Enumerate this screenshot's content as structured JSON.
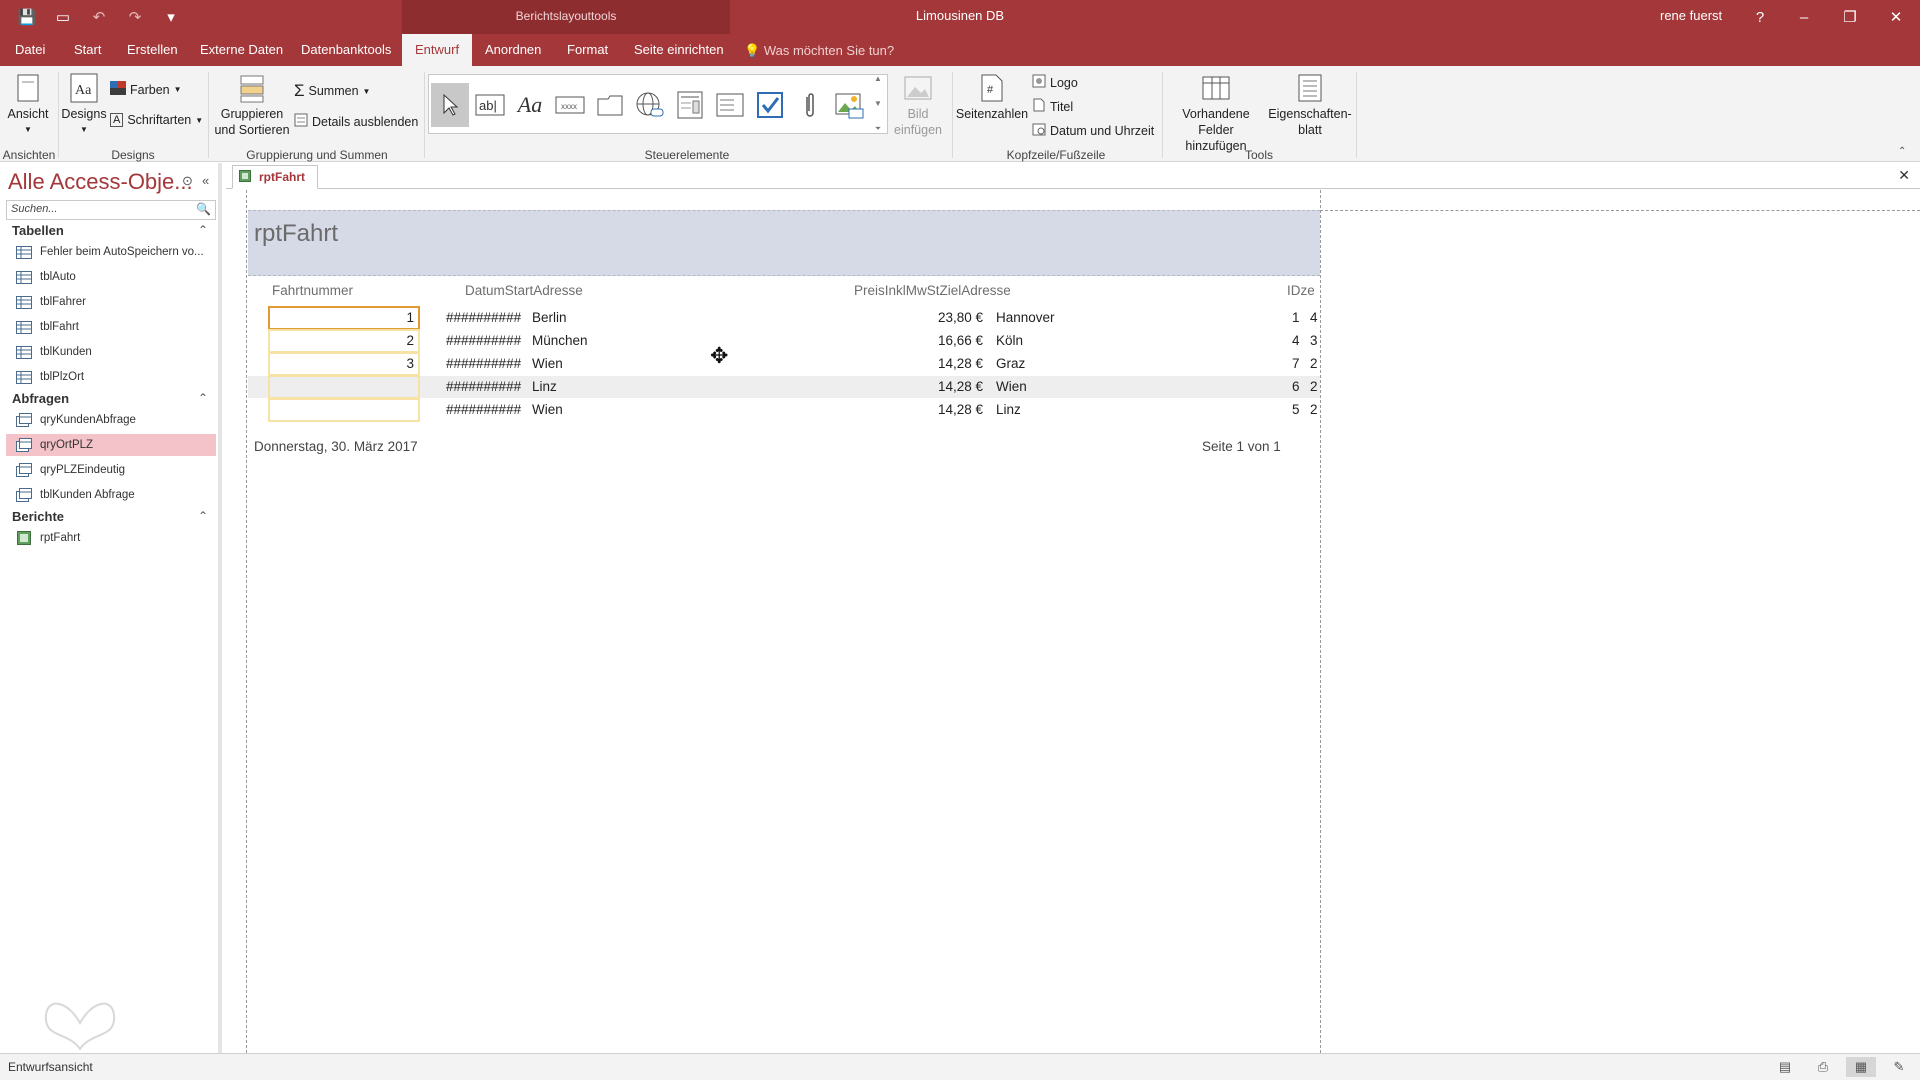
{
  "titlebar": {
    "context_title": "Berichtslayouttools",
    "app_title": "Limousinen DB",
    "user": "rene fuerst",
    "help": "?",
    "minimize": "–",
    "restore": "❐",
    "close": "✕"
  },
  "tabs": {
    "datei": "Datei",
    "start": "Start",
    "erstellen": "Erstellen",
    "externe_daten": "Externe Daten",
    "datenbanktools": "Datenbanktools",
    "entwurf": "Entwurf",
    "anordnen": "Anordnen",
    "format": "Format",
    "seite_einrichten": "Seite einrichten",
    "tell_me": "Was möchten Sie tun?"
  },
  "ribbon": {
    "ansicht": "Ansicht",
    "designs": "Designs",
    "farben": "Farben",
    "schriftarten": "Schriftarten",
    "gruppieren_1": "Gruppieren",
    "gruppieren_2": "und Sortieren",
    "summen": "Summen",
    "details_ausblenden": "Details ausblenden",
    "bild_1": "Bild",
    "bild_2": "einfügen",
    "seitenzahlen": "Seitenzahlen",
    "logo": "Logo",
    "titel": "Titel",
    "datum_uhrzeit": "Datum und Uhrzeit",
    "vorhandene_1": "Vorhandene",
    "vorhandene_2": "Felder hinzufügen",
    "eigenschaften_1": "Eigenschaften-",
    "eigenschaften_2": "blatt",
    "groups": {
      "ansichten": "Ansichten",
      "designs": "Designs",
      "gruppierung": "Gruppierung und Summen",
      "steuerelemente": "Steuerelemente",
      "kopfzeile": "Kopfzeile/Fußzeile",
      "tools": "Tools"
    }
  },
  "nav": {
    "header": "Alle Access-Obje...",
    "search_placeholder": "Suchen...",
    "tabellen": "Tabellen",
    "abfragen": "Abfragen",
    "berichte": "Berichte",
    "tables": [
      "Fehler beim AutoSpeichern vo...",
      "tblAuto",
      "tblFahrer",
      "tblFahrt",
      "tblKunden",
      "tblPlzOrt"
    ],
    "queries": [
      "qryKundenAbfrage",
      "qryOrtPLZ",
      "qryPLZEindeutig",
      "tblKunden Abfrage"
    ],
    "reports": [
      "rptFahrt"
    ]
  },
  "doc_tab": "rptFahrt",
  "report": {
    "title": "rptFahrt",
    "columns": {
      "c1": "Fahrtnummer",
      "c2": "DatumStartAdresse",
      "c3": "PreisInklMwStZielAdresse",
      "c4": "IDze"
    },
    "rows": [
      {
        "nr": "1",
        "datum": "##########",
        "start": "Berlin",
        "preis": "23,80 €",
        "ziel": "Hannover",
        "a": "1",
        "b": "4"
      },
      {
        "nr": "2",
        "datum": "##########",
        "start": "München",
        "preis": "16,66 €",
        "ziel": "Köln",
        "a": "4",
        "b": "3"
      },
      {
        "nr": "3",
        "datum": "##########",
        "start": "Wien",
        "preis": "14,28 €",
        "ziel": "Graz",
        "a": "7",
        "b": "2"
      },
      {
        "nr": "",
        "datum": "##########",
        "start": "Linz",
        "preis": "14,28 €",
        "ziel": "Wien",
        "a": "6",
        "b": "2"
      },
      {
        "nr": "",
        "datum": "##########",
        "start": "Wien",
        "preis": "14,28 €",
        "ziel": "Linz",
        "a": "5",
        "b": "2"
      }
    ],
    "footer_date": "Donnerstag, 30. März 2017",
    "footer_page": "Seite 1 von 1"
  },
  "status": {
    "text": "Entwurfsansicht"
  },
  "colors": {
    "accent": "#a4373a",
    "header_band": "#d6dae6",
    "selected_nav": "#f4c2c9"
  }
}
